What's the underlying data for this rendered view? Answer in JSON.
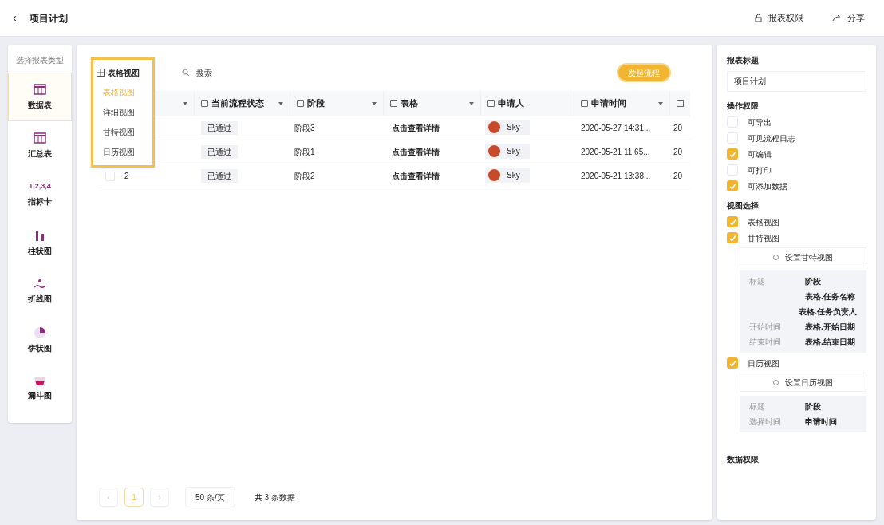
{
  "header": {
    "back": "‹",
    "title": "项目计划",
    "actions": [
      {
        "kind": "lock",
        "label": "报表权限"
      },
      {
        "kind": "share",
        "label": "分享"
      }
    ]
  },
  "sidebar": {
    "title": "选择报表类型",
    "items": [
      {
        "kind": "table",
        "label": "数据表",
        "selected": true
      },
      {
        "kind": "summary",
        "label": "汇总表",
        "selected": false
      },
      {
        "kind": "metric",
        "icon_text": "1,2,3,4",
        "label": "指标卡",
        "selected": false
      },
      {
        "kind": "bar",
        "label": "柱状图",
        "selected": false
      },
      {
        "kind": "line",
        "label": "折线图",
        "selected": false
      },
      {
        "kind": "pie",
        "label": "饼状图",
        "selected": false
      },
      {
        "kind": "funnel",
        "label": "漏斗图",
        "selected": false
      }
    ]
  },
  "toolbar": {
    "view_button": "表格视图",
    "view_menu": [
      {
        "label": "表格视图",
        "selected": true
      },
      {
        "label": "详细视图",
        "selected": false
      },
      {
        "label": "甘特视图",
        "selected": false
      },
      {
        "label": "日历视图",
        "selected": false
      }
    ],
    "search_placeholder": "搜索",
    "primary_button": "发起流程"
  },
  "table": {
    "columns": [
      {
        "label": "当前流程状态"
      },
      {
        "label": "阶段"
      },
      {
        "label": "表格"
      },
      {
        "label": "申请人"
      },
      {
        "label": "申请时间"
      }
    ],
    "rows": [
      {
        "status": "已通过",
        "stage": "阶段3",
        "form": "点击查看详情",
        "applicant": "Sky",
        "time": "2020-05-27 14:31...",
        "column_7": "20"
      },
      {
        "status": "已通过",
        "stage": "阶段1",
        "form": "点击查看详情",
        "applicant": "Sky",
        "time": "2020-05-21 11:65...",
        "column_7": "20"
      },
      {
        "checked": false,
        "first": "2",
        "status": "已通过",
        "stage": "阶段2",
        "form": "点击查看详情",
        "applicant": "Sky",
        "time": "2020-05-21 13:38...",
        "column_7": "20"
      }
    ]
  },
  "pagination": {
    "prev": "‹",
    "pages": [
      {
        "label": "1",
        "selected": true
      }
    ],
    "next": "›",
    "page_size": "50 条/页",
    "total": "共 3 条数据"
  },
  "settings": {
    "title_label": "报表标题",
    "title_value": "项目计划",
    "permissions_label": "操作权限",
    "permissions": [
      {
        "label": "可导出",
        "checked": false
      },
      {
        "label": "可见流程日志",
        "checked": false
      },
      {
        "label": "可编辑",
        "checked": true
      },
      {
        "label": "可打印",
        "checked": false
      },
      {
        "label": "可添加数据",
        "checked": true
      }
    ],
    "views_label": "视图选择",
    "views": [
      {
        "label": "表格视图",
        "checked": true
      },
      {
        "label": "甘特视图",
        "checked": true,
        "setup_button": "设置甘特视图",
        "mapping": [
          {
            "key": "标题",
            "value": "阶段"
          },
          {
            "value": "表格.任务名称"
          },
          {
            "value": "表格.任务负责人"
          },
          {
            "key": "开始时间",
            "value": "表格.开始日期"
          },
          {
            "key": "结束时间",
            "value": "表格.结束日期"
          }
        ]
      },
      {
        "label": "日历视图",
        "checked": true,
        "setup_button": "设置日历视图",
        "mapping": [
          {
            "key": "标题",
            "value": "阶段"
          },
          {
            "key": "选择时间",
            "value": "申请时间"
          }
        ]
      }
    ],
    "next_section": "数据权限"
  }
}
